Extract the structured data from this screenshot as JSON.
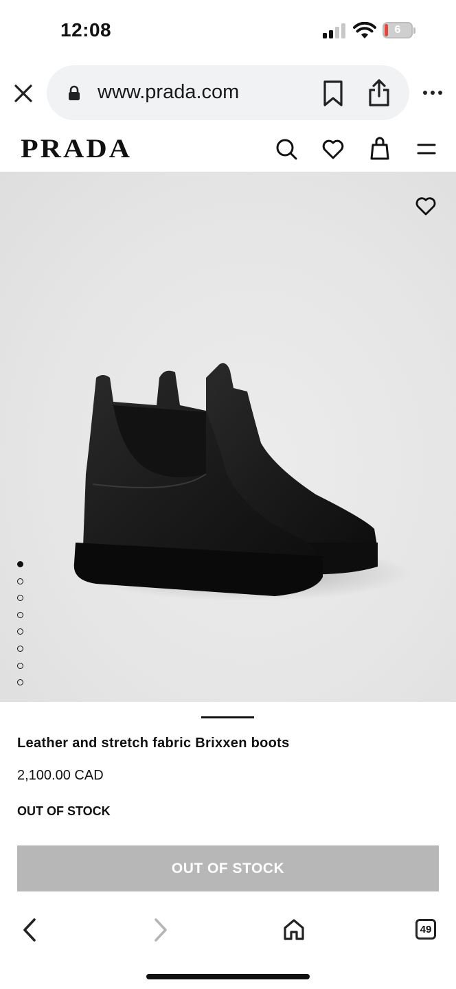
{
  "status_bar": {
    "time": "12:08",
    "battery": "6"
  },
  "browser": {
    "url": "www.prada.com",
    "tab_count": "49"
  },
  "site": {
    "logo": "PRADA"
  },
  "product": {
    "title": "Leather and stretch fabric Brixxen boots",
    "price": "2,100.00 CAD",
    "stock_status": "OUT OF STOCK",
    "button_label": "OUT OF STOCK",
    "gallery": {
      "image_count": 8,
      "active_index": 0
    }
  },
  "colors": {
    "button_disabled": "#b7b7b7",
    "battery_low": "#e5443b"
  },
  "icons": [
    "close-icon",
    "lock-icon",
    "bookmark-icon",
    "share-icon",
    "more-icon",
    "search-icon",
    "heart-icon",
    "bag-icon",
    "menu-icon",
    "back-icon",
    "forward-icon",
    "home-icon",
    "tabs-icon"
  ]
}
